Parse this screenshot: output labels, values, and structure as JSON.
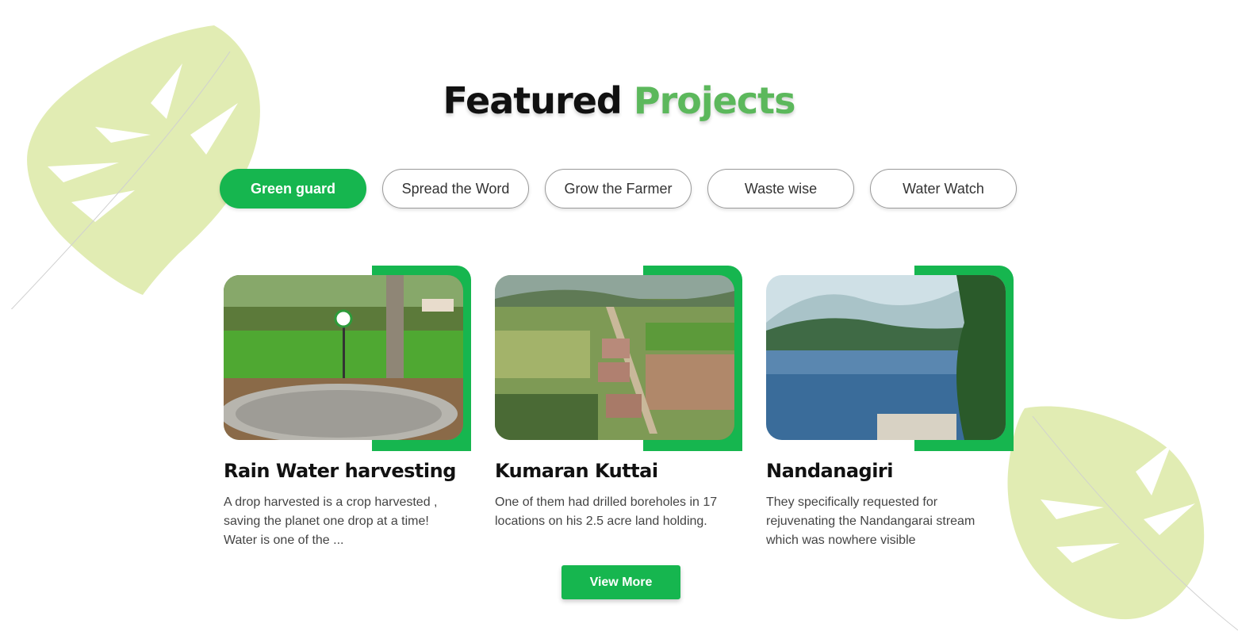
{
  "header": {
    "title_part1": "Featured",
    "title_part2": "Projects"
  },
  "tabs": [
    {
      "label": "Green guard",
      "active": true
    },
    {
      "label": "Spread the Word",
      "active": false
    },
    {
      "label": "Grow the Farmer",
      "active": false
    },
    {
      "label": "Waste wise",
      "active": false
    },
    {
      "label": "Water Watch",
      "active": false
    }
  ],
  "projects": [
    {
      "title": "Rain Water harvesting",
      "description": "A drop harvested is a crop harvested , saving the planet one drop at a time! Water is one of the ..."
    },
    {
      "title": "Kumaran Kuttai",
      "description": "One of them had drilled boreholes in 17 locations on his 2.5 acre land holding."
    },
    {
      "title": "Nandanagiri",
      "description": " They specifically requested for rejuvenating the Nandangarai stream which was nowhere visible"
    }
  ],
  "view_more_label": "View More",
  "colors": {
    "accent": "#16b64f",
    "title_green": "#5cb85c",
    "leaf": "#e1ecb3"
  },
  "icons": {
    "leaf_left": "monstera-leaf-icon",
    "leaf_right": "monstera-leaf-icon"
  }
}
